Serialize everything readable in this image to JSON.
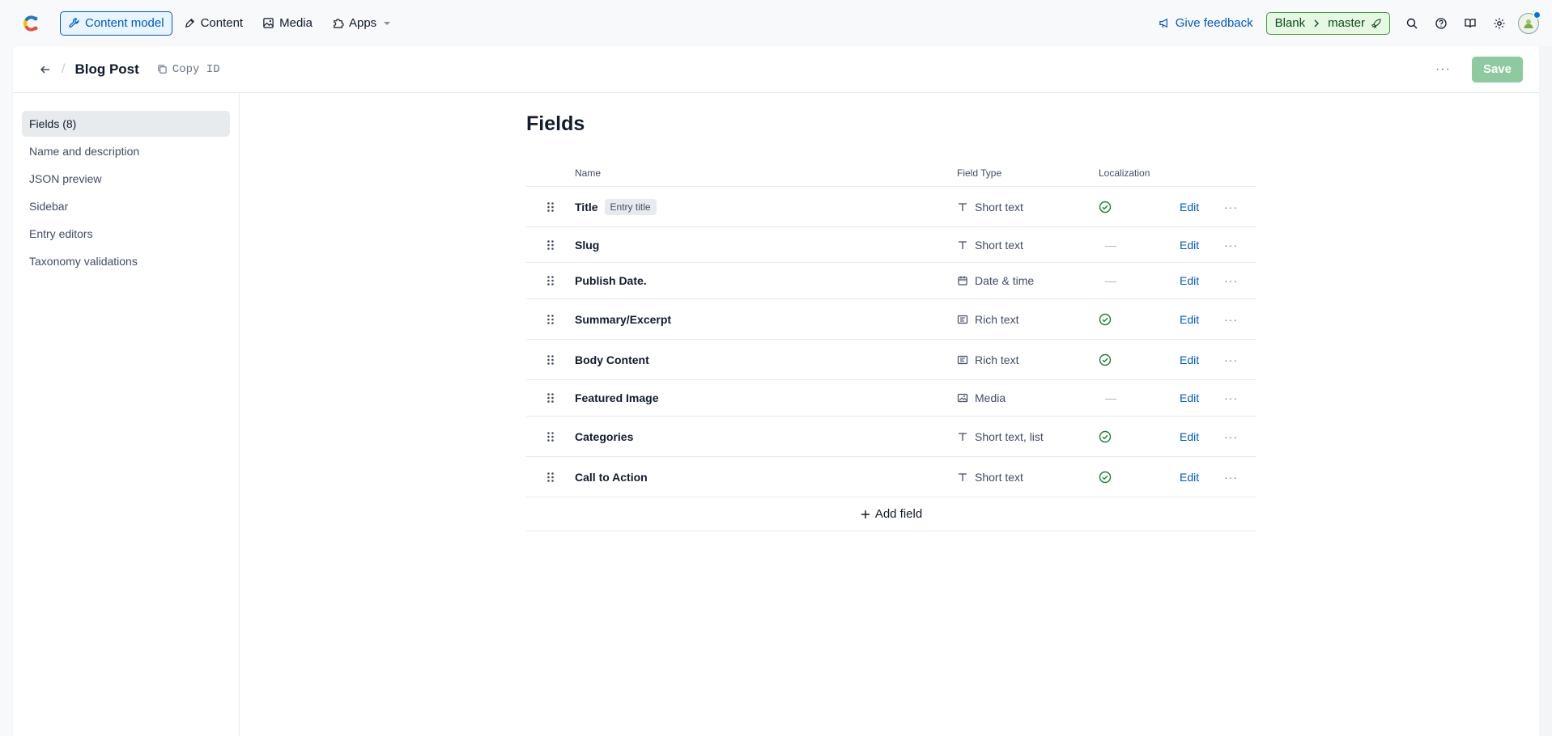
{
  "nav": {
    "items": [
      {
        "label": "Content model",
        "icon": "wrench-icon",
        "active": true
      },
      {
        "label": "Content",
        "icon": "pen-icon",
        "active": false
      },
      {
        "label": "Media",
        "icon": "image-icon",
        "active": false
      },
      {
        "label": "Apps",
        "icon": "puzzle-icon",
        "active": false
      }
    ],
    "feedback": "Give feedback",
    "env": {
      "space": "Blank",
      "branch": "master"
    }
  },
  "header": {
    "title": "Blog Post",
    "copy_id": "Copy ID",
    "more": "···",
    "save": "Save"
  },
  "sidebar": {
    "items": [
      {
        "label": "Fields (8)",
        "active": true
      },
      {
        "label": "Name and description",
        "active": false
      },
      {
        "label": "JSON preview",
        "active": false
      },
      {
        "label": "Sidebar",
        "active": false
      },
      {
        "label": "Entry editors",
        "active": false
      },
      {
        "label": "Taxonomy validations",
        "active": false
      }
    ]
  },
  "fields": {
    "heading": "Fields",
    "columns": {
      "name": "Name",
      "type": "Field Type",
      "localization": "Localization"
    },
    "rows": [
      {
        "name": "Title",
        "badge": "Entry title",
        "type": "Short text",
        "type_icon": "text-icon",
        "localized": true
      },
      {
        "name": "Slug",
        "badge": "",
        "type": "Short text",
        "type_icon": "text-icon",
        "localized": false
      },
      {
        "name": "Publish Date.",
        "badge": "",
        "type": "Date & time",
        "type_icon": "calendar-icon",
        "localized": false
      },
      {
        "name": "Summary/Excerpt",
        "badge": "",
        "type": "Rich text",
        "type_icon": "richtext-icon",
        "localized": true
      },
      {
        "name": "Body Content",
        "badge": "",
        "type": "Rich text",
        "type_icon": "richtext-icon",
        "localized": true
      },
      {
        "name": "Featured Image",
        "badge": "",
        "type": "Media",
        "type_icon": "media-icon",
        "localized": false
      },
      {
        "name": "Categories",
        "badge": "",
        "type": "Short text, list",
        "type_icon": "text-icon",
        "localized": true
      },
      {
        "name": "Call to Action",
        "badge": "",
        "type": "Short text",
        "type_icon": "text-icon",
        "localized": true
      }
    ],
    "edit_label": "Edit",
    "row_more": "···",
    "add_field": "Add field",
    "dash": "—"
  },
  "colors": {
    "accent": "#0059c8",
    "success": "#1a7f37",
    "save_disabled": "#8ecaa0"
  }
}
